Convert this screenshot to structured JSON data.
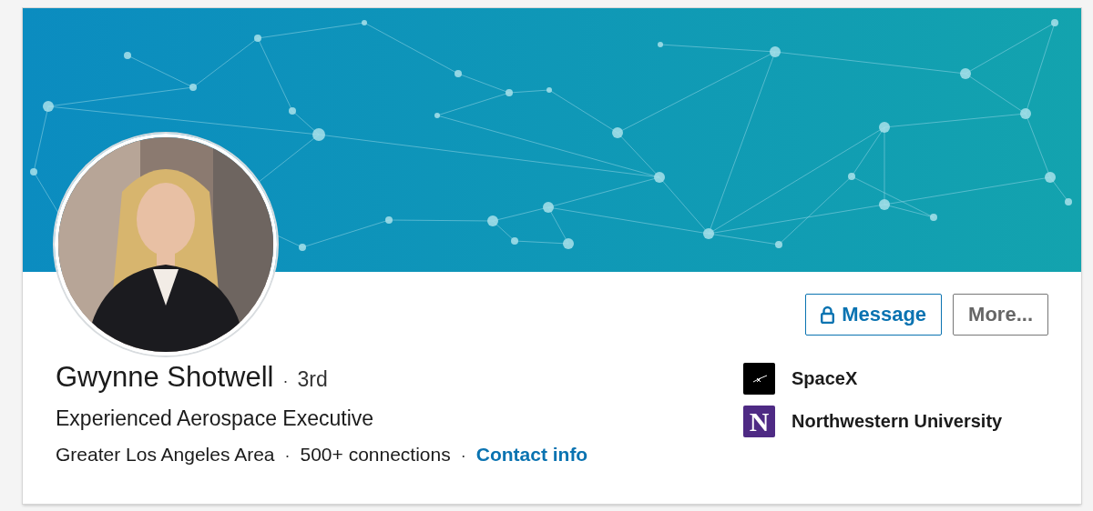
{
  "profile": {
    "name": "Gwynne Shotwell",
    "name_separator": "·",
    "degree": "3rd",
    "headline": "Experienced Aerospace Executive",
    "location": "Greater Los Angeles Area",
    "location_separators": [
      "·",
      "·"
    ],
    "connections": "500+ connections",
    "contact_link": "Contact info"
  },
  "actions": [
    {
      "label": "Message",
      "kind": "primary"
    },
    {
      "label": "More...",
      "kind": "secondary"
    }
  ],
  "organizations": [
    {
      "name": "SpaceX",
      "kind": "company"
    },
    {
      "name": "Northwestern University",
      "kind": "school",
      "logo_letter": "N"
    }
  ]
}
